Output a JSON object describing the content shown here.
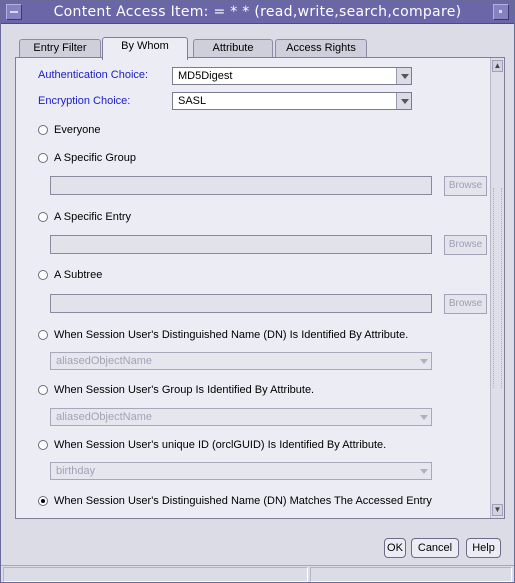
{
  "window": {
    "title": "Content Access Item: = * * (read,write,search,compare)"
  },
  "tabs": [
    {
      "label": "Entry Filter"
    },
    {
      "label": "By Whom"
    },
    {
      "label": "Attribute"
    },
    {
      "label": "Access Rights"
    }
  ],
  "auth": {
    "auth_label": "Authentication Choice:",
    "auth_value": "MD5Digest",
    "enc_label": "Encryption Choice:",
    "enc_value": "SASL"
  },
  "options": {
    "everyone": "Everyone",
    "group": "A Specific Group",
    "group_browse": "Browse",
    "entry": "A Specific Entry",
    "entry_browse": "Browse",
    "subtree": "A Subtree",
    "subtree_browse": "Browse",
    "dn_attr": "When Session User's Distinguished Name (DN) Is Identified By Attribute.",
    "dn_attr_value": "aliasedObjectName",
    "group_attr": "When Session User's Group Is Identified By Attribute.",
    "group_attr_value": "aliasedObjectName",
    "guid_attr": "When Session User's unique ID (orclGUID) Is Identified By Attribute.",
    "guid_attr_value": "birthday",
    "dn_match": "When Session User's Distinguished Name (DN) Matches The Accessed Entry",
    "selected": "dn_match"
  },
  "footer": {
    "ok_label": "OK",
    "cancel_label": "Cancel",
    "help_label": "Help"
  }
}
